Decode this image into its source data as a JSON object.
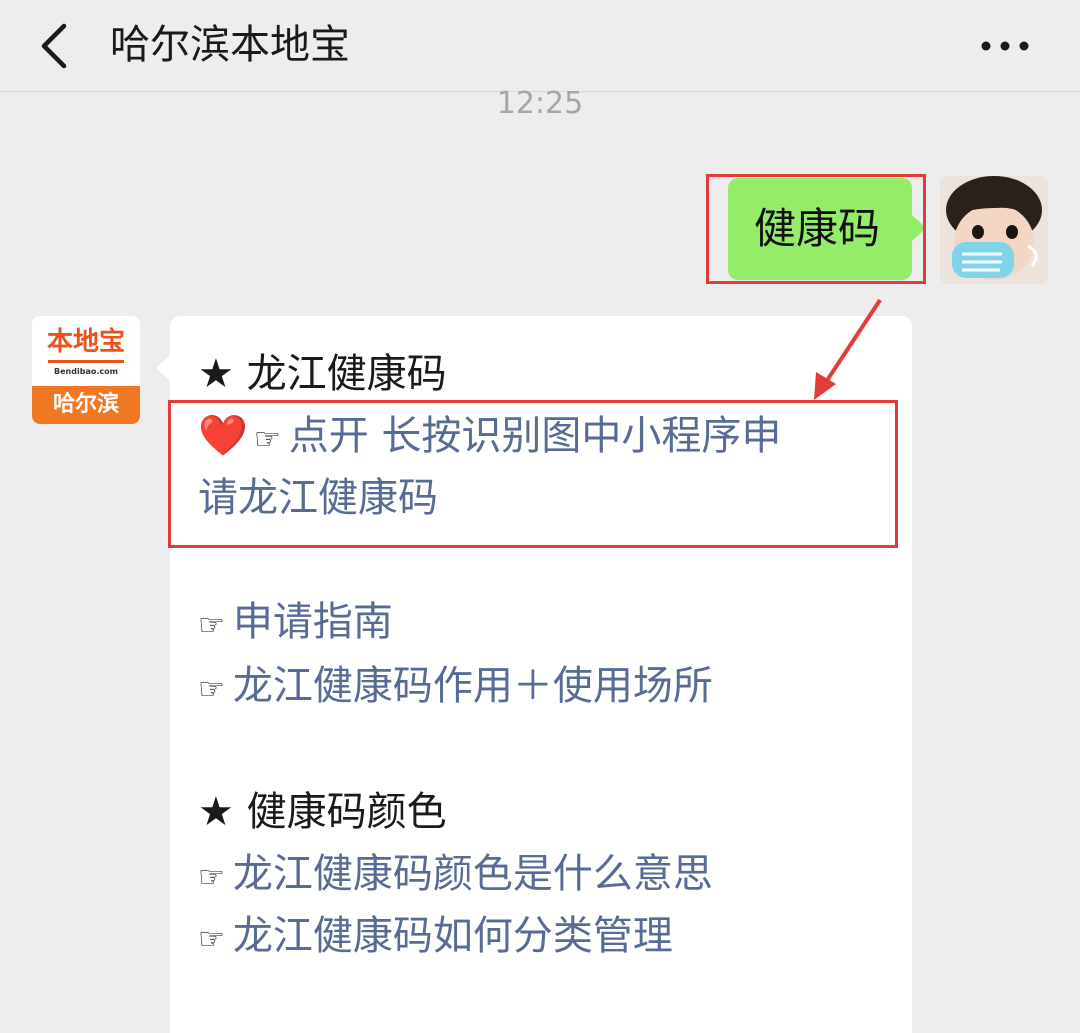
{
  "header": {
    "title": "哈尔滨本地宝",
    "back_label": "<",
    "more_label": "…"
  },
  "chat": {
    "timestamp": "12:25",
    "outgoing_message": "健康码",
    "bot_avatar": {
      "logo_text": "本地宝",
      "logo_url": "Bendibao.com",
      "logo_city": "哈尔滨"
    },
    "reply": {
      "section1_title": "★ 龙江健康码",
      "heart_symbol": "❤️",
      "hand_symbol": "☞",
      "highlight_line1": "点开 长按识别图中小程序申",
      "highlight_line2": "请龙江健康码",
      "link_guide": "申请指南",
      "link_usage": "龙江健康码作用＋使用场所",
      "section2_title": "★ 健康码颜色",
      "link_color_meaning": "龙江健康码颜色是什么意思",
      "link_classification": "龙江健康码如何分类管理"
    }
  },
  "colors": {
    "background": "#ededed",
    "bubble_outgoing": "#95ec69",
    "bubble_incoming": "#ffffff",
    "link": "#576b95",
    "annotation": "#e33a3a",
    "brand_orange": "#f07823"
  }
}
